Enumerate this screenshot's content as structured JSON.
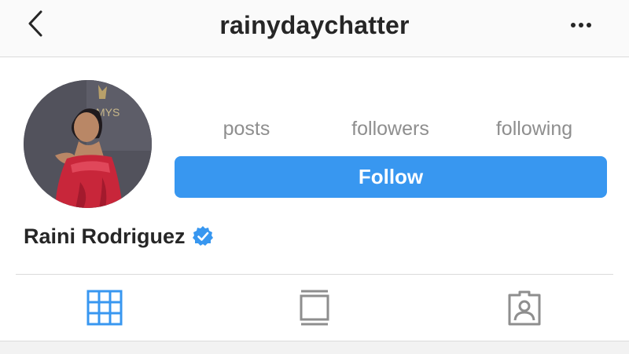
{
  "header": {
    "username": "rainydaychatter",
    "back_icon": "chevron-left-icon",
    "more_icon": "more-horizontal-icon"
  },
  "profile": {
    "avatar_icon": "profile-photo",
    "stats": {
      "posts_label": "posts",
      "followers_label": "followers",
      "following_label": "following"
    },
    "follow_label": "Follow",
    "name": "Raini Rodriguez",
    "verified_icon": "verified-badge-icon"
  },
  "tabs": {
    "items": [
      "grid-icon",
      "feed-icon",
      "tagged-icon"
    ],
    "active": "grid-icon"
  },
  "colors": {
    "accent": "#3897f0",
    "text": "#262626",
    "muted": "#8e8e8e",
    "border": "#dbdbdb",
    "header_bg": "#fafafa"
  }
}
